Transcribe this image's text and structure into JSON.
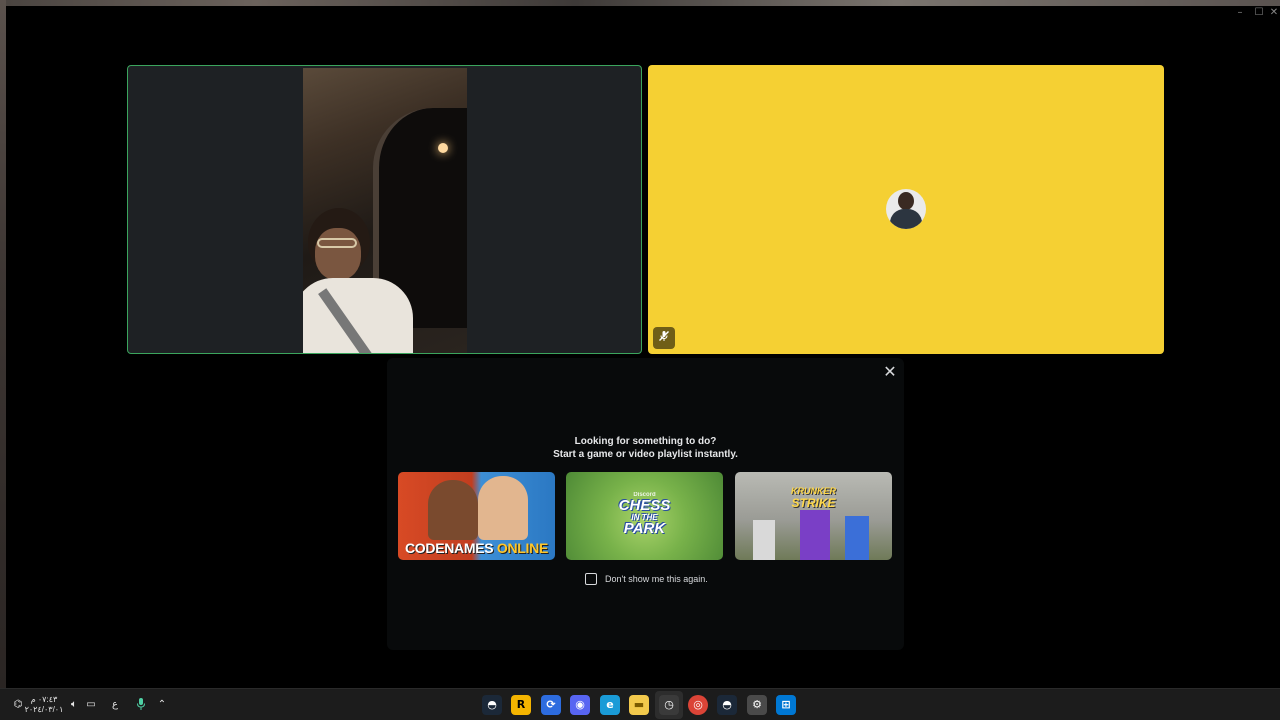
{
  "window": {
    "controls": {
      "minimize": "–",
      "maximize": "☐",
      "close": "✕"
    }
  },
  "tiles": [
    {
      "id": "camera-tile",
      "type": "video",
      "speaking": true,
      "border_color": "#3ba55d"
    },
    {
      "id": "avatar-tile",
      "type": "avatar",
      "background_color": "#f5d033",
      "muted": true,
      "muted_icon": "mic-off-icon"
    }
  ],
  "activity_panel": {
    "heading_line1": "Looking for something to do?",
    "heading_line2": "Start a game or video playlist instantly.",
    "close_icon": "close-icon",
    "activities": [
      {
        "name": "CODENAMES ONLINE",
        "title_part1": "CODENAMES ",
        "title_part2": "ONLINE"
      },
      {
        "name": "CHESS IN THE PARK",
        "brand": "Discord",
        "title_line1": "CHESS",
        "title_line2": "IN THE",
        "title_line3": "PARK"
      },
      {
        "name": "KRUNKER STRIKE",
        "title_line1": "KRUNKER",
        "title_line2": "STRIKE"
      }
    ],
    "dont_show_label": "Don't show me this again.",
    "dont_show_checked": false
  },
  "taskbar": {
    "clock_time": "٠٧:٤٣ م",
    "clock_date": "٢٠٢٤/٠٣/٠١",
    "language": "ع",
    "tray_icons": [
      "network-icon",
      "volume-icon",
      "display-icon",
      "microphone-icon",
      "chevron-up-icon"
    ],
    "apps": [
      {
        "name": "steam-icon",
        "glyph": "◓",
        "color": "#1b2838"
      },
      {
        "name": "rockstar-icon",
        "glyph": "R",
        "color": "#f4b400"
      },
      {
        "name": "blue-app-icon",
        "glyph": "⟳",
        "color": "#2d6cdf"
      },
      {
        "name": "discord-icon",
        "glyph": "◉",
        "color": "#5865f2"
      },
      {
        "name": "edge-icon",
        "glyph": "e",
        "color": "#1a9bd7"
      },
      {
        "name": "file-explorer-icon",
        "glyph": "▬",
        "color": "#f2c94c"
      },
      {
        "name": "clock-app-icon",
        "glyph": "◷",
        "color": "#3a3a3a"
      },
      {
        "name": "chrome-icon",
        "glyph": "◎",
        "color": "#db4437"
      },
      {
        "name": "steam-icon-2",
        "glyph": "◓",
        "color": "#1b2838"
      },
      {
        "name": "settings-icon",
        "glyph": "⚙",
        "color": "#4a4a4a"
      },
      {
        "name": "start-icon",
        "glyph": "⊞",
        "color": "#0078d4"
      }
    ]
  }
}
